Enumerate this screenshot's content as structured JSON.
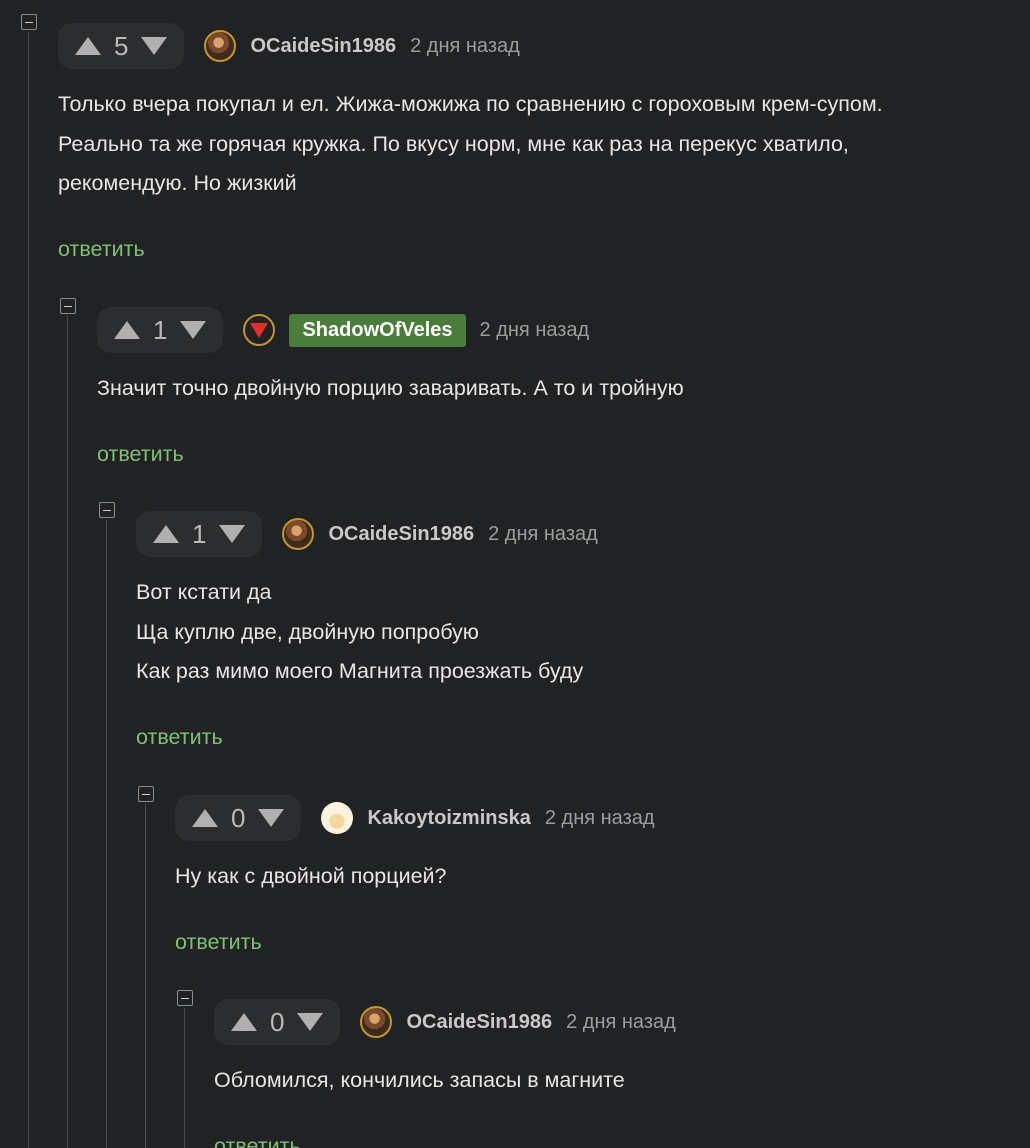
{
  "comments": [
    {
      "votes": "5",
      "username": "OCaideSin1986",
      "avatar": "user-avatar-photo",
      "time": "2 дня назад",
      "lines": [
        "Только вчера покупал и ел. Жижа-можижа по сравнению с гороховым крем-супом.",
        "Реально та же горячая кружка. По вкусу норм, мне как раз на перекус хватило,",
        "рекомендую. Но жизкий"
      ],
      "reply": "ответить"
    },
    {
      "votes": "1",
      "username": "ShadowOfVeles",
      "avatar": "red-triangle-icon",
      "badge_color": "#4c7c3b",
      "time": "2 дня назад",
      "lines": [
        "Значит точно двойную порцию заваривать. А то и тройную"
      ],
      "reply": "ответить"
    },
    {
      "votes": "1",
      "username": "OCaideSin1986",
      "avatar": "user-avatar-photo",
      "time": "2 дня назад",
      "lines": [
        "Вот кстати да",
        "Ща куплю две, двойную попробую",
        "Как раз мимо моего Магнита проезжать буду"
      ],
      "reply": "ответить"
    },
    {
      "votes": "0",
      "username": "Kakoytoizminska",
      "avatar": "user-avatar-light",
      "time": "2 дня назад",
      "lines": [
        "Ну как с двойной порцией?"
      ],
      "reply": "ответить"
    },
    {
      "votes": "0",
      "username": "OCaideSin1986",
      "avatar": "user-avatar-photo",
      "time": "2 дня назад",
      "lines": [
        "Обломился, кончились запасы в магните"
      ],
      "reply": "ответить"
    }
  ],
  "colors": {
    "background": "#202223",
    "vote_box": "#2b2d2e",
    "reply_link": "#7fc073",
    "thread_line": "#4a4c4d",
    "avatar_ring": "#c2962c"
  }
}
